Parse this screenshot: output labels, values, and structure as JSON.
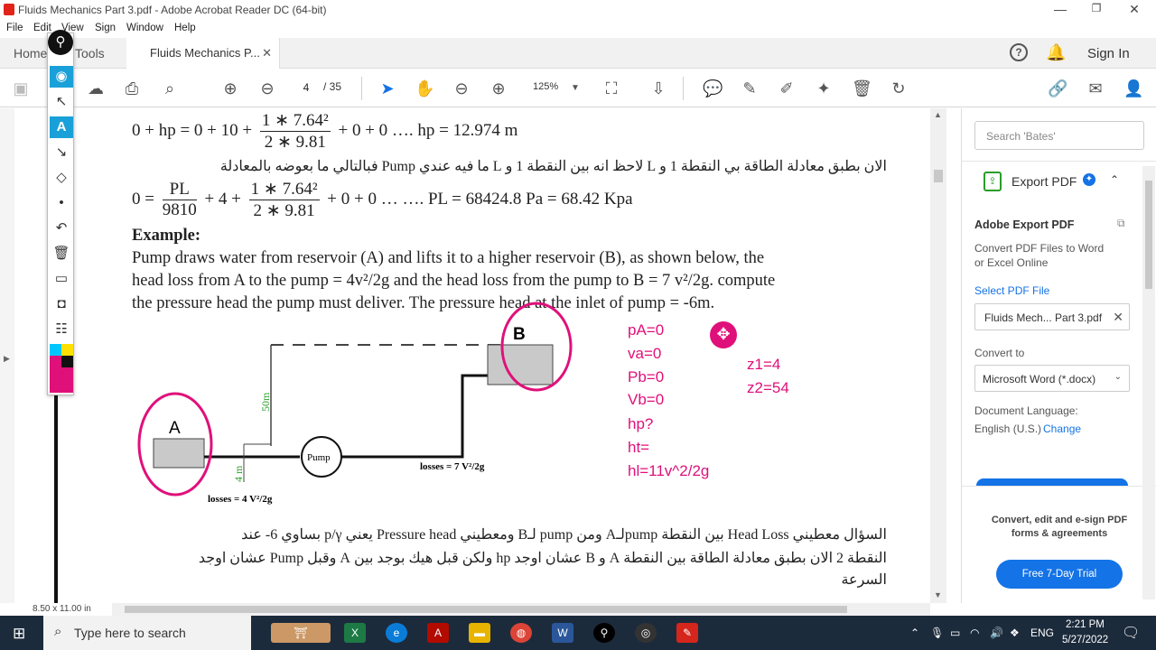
{
  "window": {
    "title": "Fluids Mechanics  Part 3.pdf - Adobe Acrobat Reader DC (64-bit)",
    "minimize": "—",
    "restore": "❐",
    "close": "✕"
  },
  "menu": [
    "File",
    "Edit",
    "View",
    "Sign",
    "Window",
    "Help"
  ],
  "tabs": {
    "home": "Home",
    "tools": "Tools",
    "document": "Fluids Mechanics  P...",
    "document_close": "✕",
    "help": "?",
    "sign_in": "Sign In"
  },
  "toolbar": {
    "page_current": "4",
    "page_total": "/ 35",
    "zoom": "125%"
  },
  "document": {
    "eq1": {
      "left": "0 + hp = 0 + 10 +",
      "num": "1 ∗ 7.64²",
      "den": "2 ∗ 9.81",
      "right": "+ 0 + 0 …. hp = 12.974 m"
    },
    "arabic1": "الان بطبق معادلة الطاقة بي النقطة 1 و L لاحظ انه بين النقطة 1 و L ما فيه عندي Pump فبالتالي ما بعوضه بالمعادلة",
    "eq2": {
      "lead": "0 =",
      "num1": "PL",
      "den1": "9810",
      "mid": "+ 4 +",
      "num2": "1 ∗ 7.64²",
      "den2": "2 ∗ 9.81",
      "right": "+ 0 + 0 … …. PL = 68424.8 Pa = 68.42 Kpa"
    },
    "example_heading": "Example:",
    "example_lines": [
      "Pump draws water from reservoir (A) and lifts it to a higher reservoir (B), as shown below, the",
      "head loss from A to the pump = 4v²/2g and the head loss from the pump  to B = 7 v²/2g. compute",
      "the pressure head the pump must deliver. The pressure head at the inlet of pump = -6m."
    ],
    "diagram": {
      "label_a": "A",
      "label_b": "B",
      "height": "50m",
      "pump": "Pump",
      "losses_a": "losses = 4 V²/2g",
      "losses_b": "losses = 7 V²/2g",
      "small_dim": "4 m"
    },
    "annotations": {
      "col1": [
        "pA=0",
        "va=0",
        "Pb=0",
        "Vb=0",
        "hp?",
        "ht=",
        "hl=11v^2/2g"
      ],
      "col2": [
        "z1=4",
        "z2=54"
      ]
    },
    "arabic2": [
      "السؤال معطيني Head Loss بين النقطة pumpلـA ومن pump لـB ومعطيني Pressure head يعني p/γ بساوي 6- عند",
      "النقطة 2 الان بطبق معادلة الطاقة بين النقطة A و B عشان اوجد hp ولكن قبل هيك بوجد بين A وقبل Pump عشان اوجد",
      "السرعة"
    ],
    "page_size": "8.50 x 11.00 in"
  },
  "side_panel": {
    "search_placeholder": "Search 'Bates'",
    "export_title": "Export PDF",
    "adobe_export_title": "Adobe Export PDF",
    "adobe_export_desc_1": "Convert PDF Files to Word",
    "adobe_export_desc_2": "or Excel Online",
    "select_file_label": "Select PDF File",
    "selected_file": "Fluids Mech... Part 3.pdf",
    "convert_to_label": "Convert to",
    "convert_to_value": "Microsoft Word (*.docx)",
    "doc_language_label": "Document Language:",
    "doc_language_value": "English (U.S.)",
    "change_link": "Change",
    "promo_line_1": "Convert, edit and e-sign PDF",
    "promo_line_2": "forms & agreements",
    "trial_button": "Free 7-Day Trial"
  },
  "taskbar": {
    "search_placeholder": "Type here to search",
    "language": "ENG",
    "time": "2:21 PM",
    "date": "5/27/2022"
  },
  "colors": {
    "accent_blue": "#1473e6",
    "annotation_pink": "#e0107a",
    "taskbar": "#1c2b3c"
  }
}
